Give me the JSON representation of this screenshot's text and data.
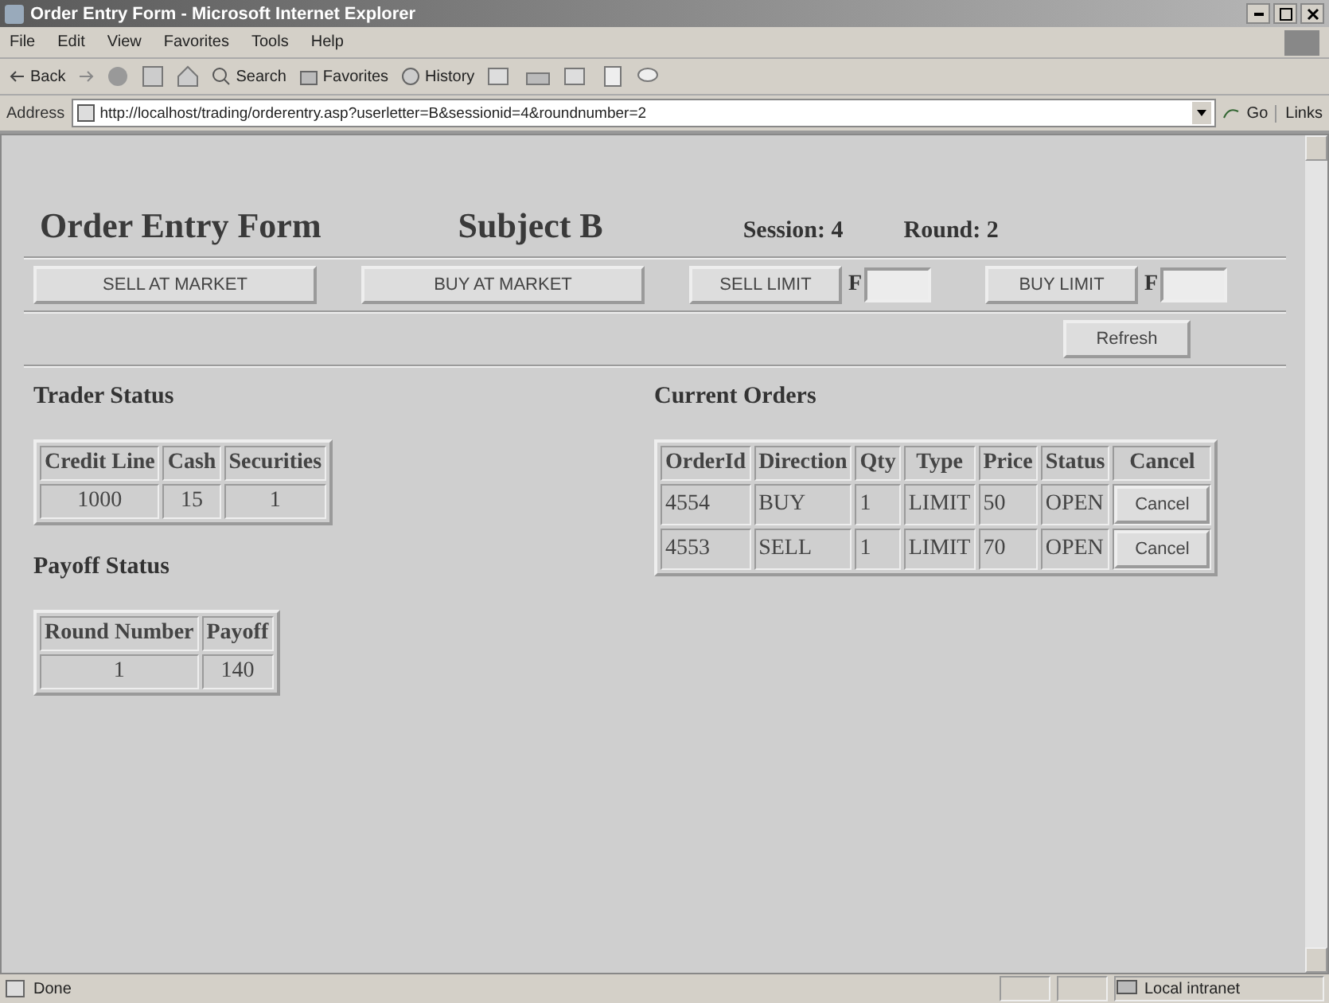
{
  "window": {
    "title": "Order Entry Form - Microsoft Internet Explorer"
  },
  "menu": [
    "File",
    "Edit",
    "View",
    "Favorites",
    "Tools",
    "Help"
  ],
  "toolbar": {
    "back": "Back",
    "search": "Search",
    "favorites": "Favorites",
    "history": "History"
  },
  "address_bar": {
    "label": "Address",
    "url": "http://localhost/trading/orderentry.asp?userletter=B&sessionid=4&roundnumber=2",
    "go": "Go",
    "links": "Links"
  },
  "header": {
    "title": "Order Entry Form",
    "subject": "Subject B",
    "session": "Session: 4",
    "round": "Round: 2"
  },
  "order_buttons": [
    {
      "kind": "market",
      "label": "SELL AT MARKET"
    },
    {
      "kind": "market",
      "label": "BUY AT MARKET"
    },
    {
      "kind": "limit",
      "label": "SELL LIMIT",
      "field_label": "F"
    },
    {
      "kind": "limit",
      "label": "BUY LIMIT",
      "field_label": "F"
    }
  ],
  "refresh": "Refresh",
  "trader_status": {
    "heading": "Trader Status",
    "columns": [
      "Credit Line",
      "Cash",
      "Securities"
    ],
    "row": [
      "1000",
      "15",
      "1"
    ]
  },
  "payoff_status": {
    "heading": "Payoff Status",
    "columns": [
      "Round Number",
      "Payoff"
    ],
    "row": [
      "1",
      "140"
    ]
  },
  "current_orders": {
    "heading": "Current Orders",
    "columns": [
      "OrderId",
      "Direction",
      "Qty",
      "Type",
      "Price",
      "Status",
      "Cancel"
    ],
    "rows": [
      {
        "cells": [
          "4554",
          "BUY",
          "1",
          "LIMIT",
          "50",
          "OPEN"
        ],
        "action": "Cancel"
      },
      {
        "cells": [
          "4553",
          "SELL",
          "1",
          "LIMIT",
          "70",
          "OPEN"
        ],
        "action": "Cancel"
      }
    ]
  },
  "status_bar": {
    "text": "Done",
    "zone": "Local intranet"
  }
}
